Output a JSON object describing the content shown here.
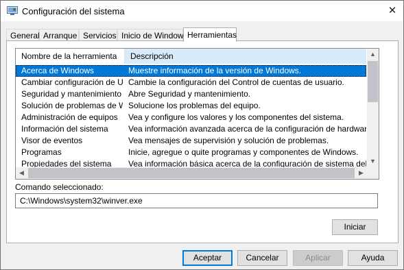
{
  "window": {
    "title": "Configuración del sistema",
    "close_glyph": "✕",
    "icon": "system-config-icon"
  },
  "tabs": [
    {
      "label": "General",
      "active": false
    },
    {
      "label": "Arranque",
      "active": false
    },
    {
      "label": "Servicios",
      "active": false
    },
    {
      "label": "Inicio de Windows",
      "active": false
    },
    {
      "label": "Herramientas",
      "active": true
    }
  ],
  "tools": {
    "columns": [
      "Nombre de la herramienta",
      "Descripción"
    ],
    "rows": [
      [
        "Acerca de Windows",
        "Muestre información de la versión de Windows."
      ],
      [
        "Cambiar configuración de UAC",
        "Cambie la configuración del Control de cuentas de usuario."
      ],
      [
        "Seguridad y mantenimiento",
        "Abre Seguridad y mantenimiento."
      ],
      [
        "Solución de problemas de Wi...",
        "Solucione los problemas del equipo."
      ],
      [
        "Administración de equipos",
        "Vea y configure los valores y los componentes del sistema."
      ],
      [
        "Información del sistema",
        "Vea información avanzada acerca de la configuración de hardware y sof"
      ],
      [
        "Visor de eventos",
        "Vea mensajes de supervisión y solución de problemas."
      ],
      [
        "Programas",
        "Inicie, agregue o quite programas y componentes de Windows."
      ],
      [
        "Propiedades del sistema",
        "Vea información básica acerca de la configuración de sistema del equipo"
      ]
    ],
    "selected_row": 0,
    "scroll_up": "▲",
    "scroll_down": "▼",
    "scroll_left": "◀",
    "scroll_right": "▶"
  },
  "command": {
    "label": "Comando seleccionado:",
    "value": "C:\\Windows\\system32\\winver.exe"
  },
  "buttons": {
    "launch": "Iniciar",
    "ok": "Aceptar",
    "cancel": "Cancelar",
    "apply": "Aplicar",
    "help": "Ayuda"
  },
  "colors": {
    "selection": "#0078d7",
    "header_highlight": "#d9ebf9"
  }
}
